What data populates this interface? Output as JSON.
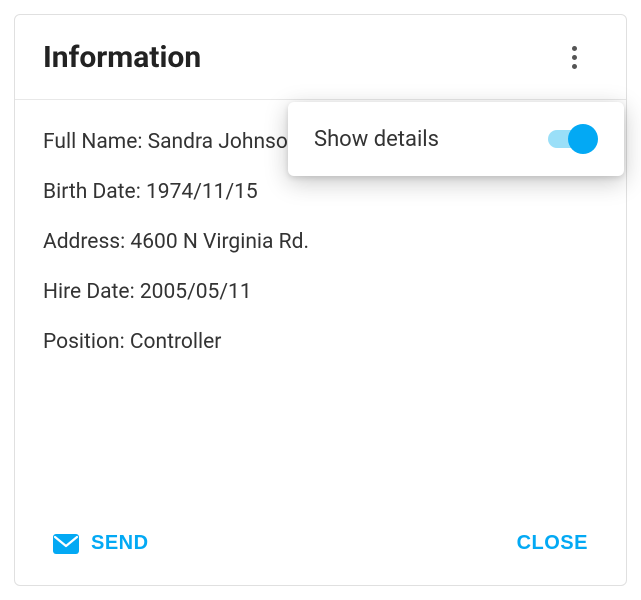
{
  "card": {
    "title": "Information",
    "fields": [
      {
        "label": "Full Name",
        "value": "Sandra Johnson"
      },
      {
        "label": "Birth Date",
        "value": "1974/11/15"
      },
      {
        "label": "Address",
        "value": "4600 N Virginia Rd."
      },
      {
        "label": "Hire Date",
        "value": "2005/05/11"
      },
      {
        "label": "Position",
        "value": "Controller"
      }
    ],
    "actions": {
      "send_label": "SEND",
      "close_label": "CLOSE"
    }
  },
  "popup": {
    "label": "Show details",
    "switch_on": true
  }
}
